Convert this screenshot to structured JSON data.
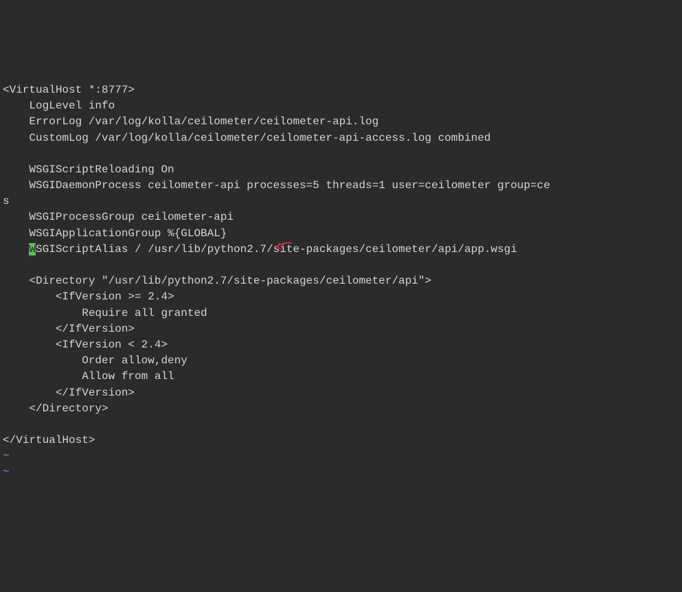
{
  "lines": {
    "l1": "<VirtualHost *:8777>",
    "l2": "    LogLevel info",
    "l3": "    ErrorLog /var/log/kolla/ceilometer/ceilometer-api.log",
    "l4": "    CustomLog /var/log/kolla/ceilometer/ceilometer-api-access.log combined",
    "l5": "",
    "l6": "    WSGIScriptReloading On",
    "l7": "    WSGIDaemonProcess ceilometer-api processes=5 threads=1 user=ceilometer group=ce",
    "l8": "s",
    "l9": "    WSGIProcessGroup ceilometer-api",
    "l10": "    WSGIApplicationGroup %{GLOBAL}",
    "l11_indent": "    ",
    "l11_cursor": "W",
    "l11_rest": "SGIScriptAlias / /usr/lib/python2.7/site-packages/ceilometer/api/app.wsgi",
    "l12": "",
    "l13": "    <Directory \"/usr/lib/python2.7/site-packages/ceilometer/api\">",
    "l14": "        <IfVersion >= 2.4>",
    "l15": "            Require all granted",
    "l16": "        </IfVersion>",
    "l17": "        <IfVersion < 2.4>",
    "l18": "            Order allow,deny",
    "l19": "            Allow from all",
    "l20": "        </IfVersion>",
    "l21": "    </Directory>",
    "l22": "",
    "l23": "</VirtualHost>",
    "tilde": "~"
  },
  "annotation": {
    "type": "arrow",
    "color": "#c9302c",
    "points_to": "WSGIApplicationGroup line"
  }
}
